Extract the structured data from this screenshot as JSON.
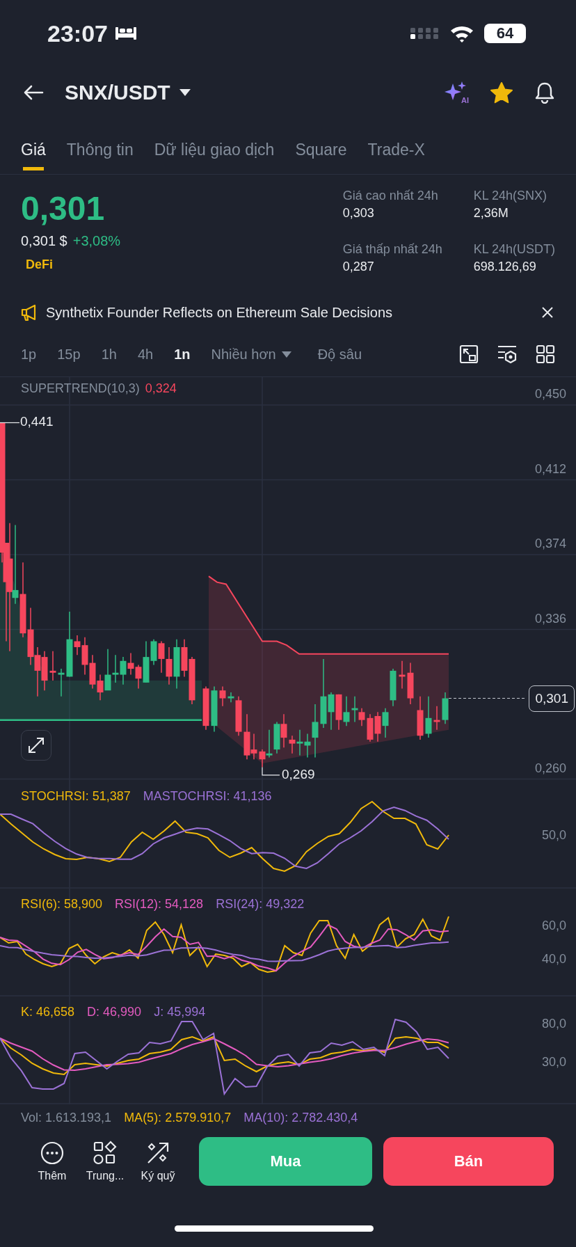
{
  "status_bar": {
    "time": "23:07",
    "battery": "64"
  },
  "header": {
    "pair": "SNX/USDT",
    "ai_badge": "AI",
    "favorite": true
  },
  "tabs": [
    {
      "label": "Giá",
      "selected": true
    },
    {
      "label": "Thông tin",
      "selected": false
    },
    {
      "label": "Dữ liệu giao dịch",
      "selected": false
    },
    {
      "label": "Square",
      "selected": false
    },
    {
      "label": "Trade-X",
      "selected": false
    }
  ],
  "price": {
    "last": "0,301",
    "fiat": "0,301 $",
    "change": "+3,08%",
    "tag": "DeFi"
  },
  "stats": [
    {
      "label": "Giá cao nhất 24h",
      "value": "0,303"
    },
    {
      "label": "KL 24h(SNX)",
      "value": "2,36M"
    },
    {
      "label": "Giá thấp nhất 24h",
      "value": "0,287"
    },
    {
      "label": "KL 24h(USDT)",
      "value": "698.126,69"
    }
  ],
  "news": {
    "text": "Synthetix Founder Reflects on Ethereum Sale Decisions"
  },
  "intervals": [
    {
      "label": "1p",
      "selected": false
    },
    {
      "label": "15p",
      "selected": false
    },
    {
      "label": "1h",
      "selected": false
    },
    {
      "label": "4h",
      "selected": false
    },
    {
      "label": "1n",
      "selected": true
    }
  ],
  "more": "Nhiều hơn",
  "depth": "Độ sâu",
  "chart": {
    "indicator": "SUPERTREND(10,3)",
    "indicator_value": "0,324",
    "y_labels": [
      "0,450",
      "0,412",
      "0,374",
      "0,336",
      "0,260"
    ],
    "high_label": "0,441",
    "low_label": "0,269",
    "last_price": "0,301"
  },
  "panels": [
    {
      "labels": [
        {
          "text": "STOCHRSI: 51,387",
          "color": "#f0b90b"
        },
        {
          "text": "MASTOCHRSI: 41,136",
          "color": "#9b72d6"
        }
      ],
      "y_labels": [
        "50,0"
      ]
    },
    {
      "labels": [
        {
          "text": "RSI(6): 58,900",
          "color": "#f0b90b"
        },
        {
          "text": "RSI(12): 54,128",
          "color": "#e45bc0"
        },
        {
          "text": "RSI(24): 49,322",
          "color": "#9b72d6"
        }
      ],
      "y_labels": [
        "60,0",
        "40,0"
      ]
    },
    {
      "labels": [
        {
          "text": "K: 46,658",
          "color": "#f0b90b"
        },
        {
          "text": "D: 46,990",
          "color": "#e45bc0"
        },
        {
          "text": "J: 45,994",
          "color": "#9b72d6"
        }
      ],
      "y_labels": [
        "80,0",
        "30,0"
      ]
    }
  ],
  "volume": [
    {
      "text": "Vol: 1.613.193,1",
      "color": "#848e9c"
    },
    {
      "text": "MA(5): 2.579.910,7",
      "color": "#f0b90b"
    },
    {
      "text": "MA(10): 2.782.430,4",
      "color": "#9b72d6"
    }
  ],
  "actions": [
    {
      "kind": "more",
      "label": "Thêm"
    },
    {
      "kind": "apps",
      "label": "Trung..."
    },
    {
      "kind": "margin",
      "label": "Ký quỹ"
    }
  ],
  "buy": "Mua",
  "sell": "Bán"
}
